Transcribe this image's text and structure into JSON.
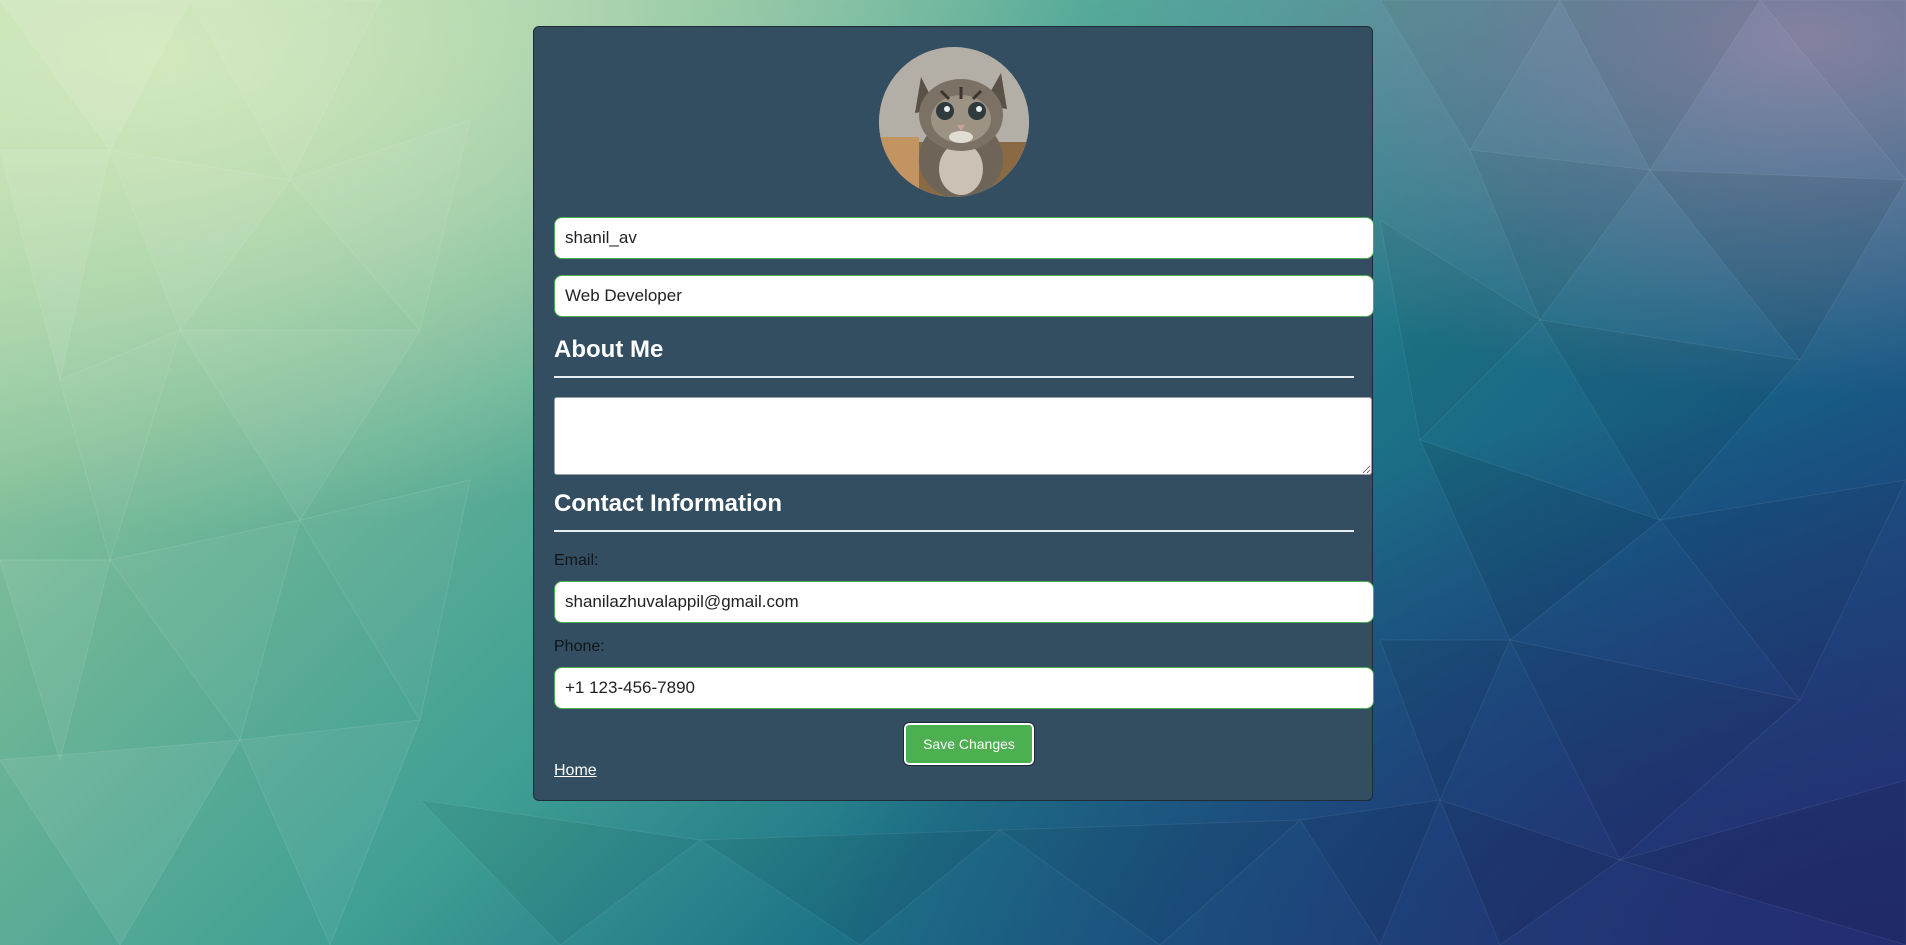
{
  "profile": {
    "avatar_alt": "kitten-photo",
    "username": "shanil_av",
    "job_title": "Web Developer"
  },
  "about": {
    "heading": "About Me",
    "text": ""
  },
  "contact": {
    "heading": "Contact Information",
    "email_label": "Email:",
    "email": "shanilazhuvalappil@gmail.com",
    "phone_label": "Phone:",
    "phone": "+1 123-456-7890"
  },
  "actions": {
    "save_label": "Save Changes",
    "home_label": "Home"
  },
  "colors": {
    "card": "#344e61",
    "accent": "#4caf50",
    "background_start": "#cfe6b7",
    "background_end": "#233a7a"
  }
}
